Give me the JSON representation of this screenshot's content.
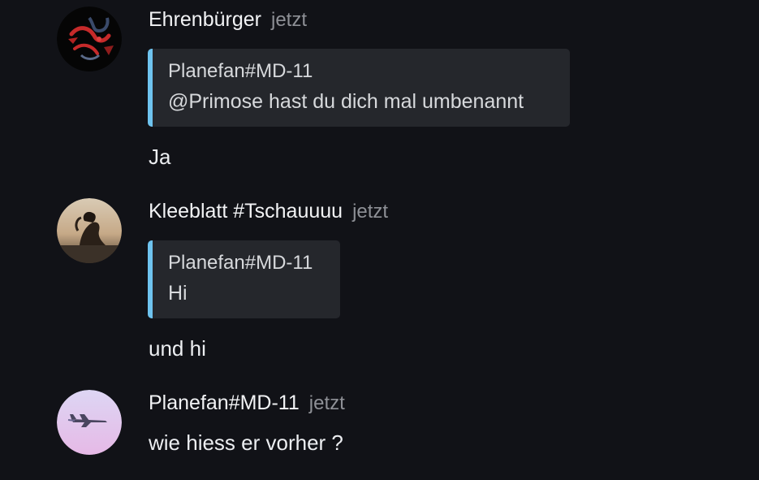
{
  "messages": [
    {
      "author": "Ehrenbürger",
      "time": "jetzt",
      "quote": {
        "author": "Planefan#MD-11",
        "text": "@Primose hast du dich mal umbenannt"
      },
      "text": "Ja",
      "avatar_icon": "dragon-avatar"
    },
    {
      "author": "Kleeblatt #Tschauuuu",
      "time": "jetzt",
      "quote": {
        "author": "Planefan#MD-11",
        "text": "Hi"
      },
      "text": "und hi",
      "avatar_icon": "person-photo-avatar"
    },
    {
      "author": "Planefan#MD-11",
      "time": "jetzt",
      "text": "wie hiess er vorher ?",
      "avatar_icon": "airplane-avatar"
    }
  ],
  "colors": {
    "background": "#111217",
    "quote_bar": "#6ec3ef",
    "quote_bg": "#25272c",
    "timestamp": "#8e9096"
  }
}
